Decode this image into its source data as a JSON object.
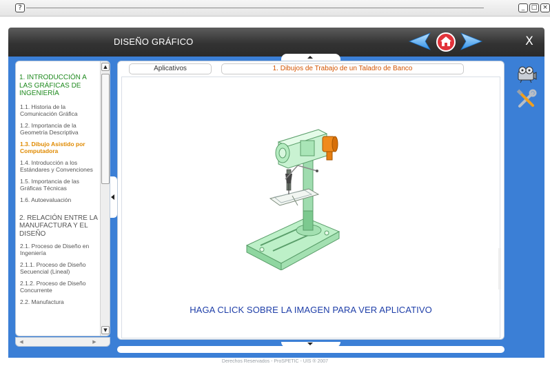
{
  "window": {
    "help_glyph": "?",
    "controls": [
      "_",
      "□",
      "×"
    ]
  },
  "header": {
    "title": "DISEÑO GRÁFICO",
    "close_label": "X"
  },
  "colors": {
    "header_bg": "#333333",
    "body_bg": "#3b7fd6",
    "section_green": "#1f8a1f",
    "active_orange": "#e08a00",
    "cta_blue": "#1e3ea8",
    "nav_arrow": "#4aa6f0",
    "home_red": "#e2333a"
  },
  "sidebar": {
    "items": [
      {
        "label": "1. INTRODUCCIÓN A LAS GRÁFICAS DE INGENIERÍA",
        "kind": "section",
        "state": "highlight"
      },
      {
        "label": "1.1. Historia de la Comunicación Gráfica",
        "kind": "item"
      },
      {
        "label": "1.2. Importancia de la Geometría Descriptiva",
        "kind": "item"
      },
      {
        "label": "1.3. Dibujo Asistido por Computadora",
        "kind": "item",
        "state": "active"
      },
      {
        "label": "1.4. Introducción a los Estándares y Convenciones",
        "kind": "item"
      },
      {
        "label": "1.5. Importancia de las Gráficas Técnicas",
        "kind": "item"
      },
      {
        "label": "1.6. Autoevaluación",
        "kind": "item"
      },
      {
        "label": "2. RELACIÓN ENTRE LA MANUFACTURA Y EL DISEÑO",
        "kind": "section"
      },
      {
        "label": "2.1. Proceso de Diseño en Ingeniería",
        "kind": "item"
      },
      {
        "label": "2.1.1. Proceso de Diseño Secuencial (Lineal)",
        "kind": "item"
      },
      {
        "label": "2.1.2. Proceso de Diseño Concurrente",
        "kind": "item"
      },
      {
        "label": "2.2. Manufactura",
        "kind": "item"
      }
    ]
  },
  "main": {
    "tab_label": "Aplicativos",
    "content_title": "1. Dibujos de Trabajo de un Taladro de Banco",
    "image_name": "drill-press-3d-illustration",
    "cta": "HAGA CLICK SOBRE LA IMAGEN PARA VER APLICATIVO"
  },
  "tools": {
    "icons": [
      "projector-icon",
      "tools-icon"
    ]
  },
  "footer": {
    "text": "Derechos Reservados - ProSPETIC - UIS ® 2007"
  }
}
